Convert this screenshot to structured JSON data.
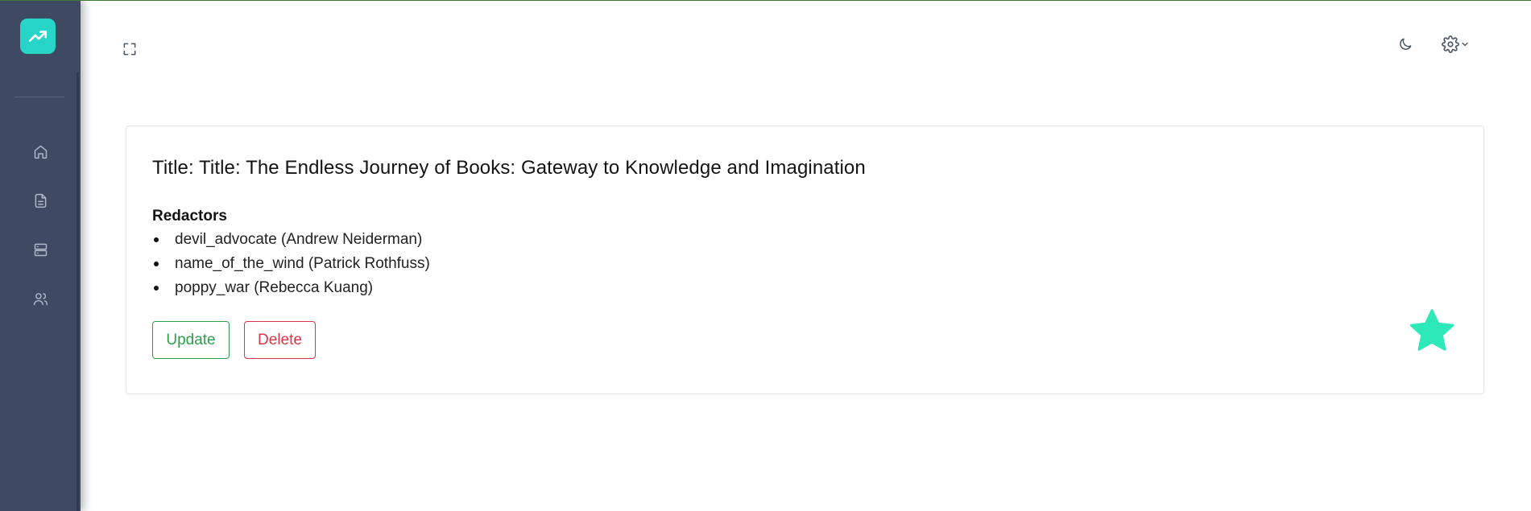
{
  "colors": {
    "sidebar": "#3e4a62",
    "logo": "#26d4c8",
    "accent_star": "#2de8b8",
    "update": "#2e9e4d",
    "delete": "#dc3545"
  },
  "sidebar": {
    "logo_icon": "trending-up-icon",
    "items": [
      {
        "icon": "home-icon"
      },
      {
        "icon": "document-icon"
      },
      {
        "icon": "server-icon"
      },
      {
        "icon": "users-icon"
      }
    ]
  },
  "header": {
    "fullscreen_icon": "fullscreen-icon",
    "theme_icon": "moon-icon",
    "settings_icon": "gear-icon",
    "settings_dropdown_icon": "chevron-down-icon"
  },
  "book": {
    "title": "Title: Title: The Endless Journey of Books: Gateway to Knowledge and Imagination",
    "redactors_label": "Redactors",
    "redactors": [
      "devil_advocate (Andrew Neiderman)",
      "name_of_the_wind (Patrick Rothfuss)",
      "poppy_war (Rebecca Kuang)"
    ],
    "update_label": "Update",
    "delete_label": "Delete",
    "favorite_icon": "star-icon"
  }
}
